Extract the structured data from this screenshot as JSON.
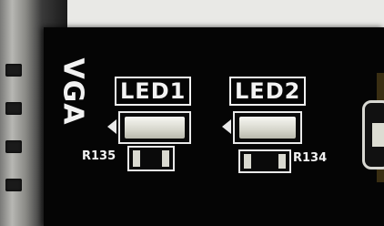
{
  "silkscreen": {
    "vga": "VGA",
    "led1": "LED1",
    "led2": "LED2",
    "r135": "R135",
    "r134": "R134"
  }
}
